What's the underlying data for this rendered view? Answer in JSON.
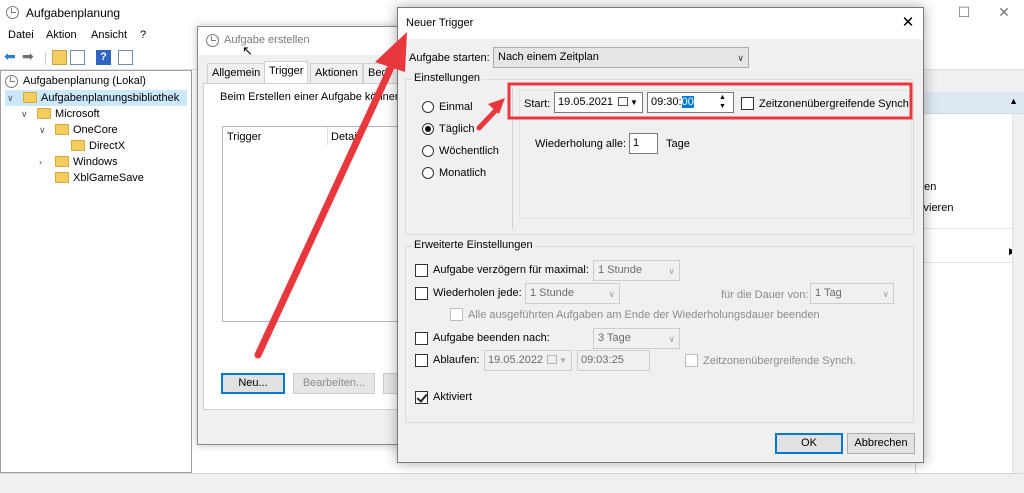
{
  "main": {
    "title": "Aufgabenplanung",
    "menu": [
      "Datei",
      "Aktion",
      "Ansicht",
      "?"
    ],
    "tree": {
      "root": "Aufgabenplanung (Lokal)",
      "library": "Aufgabenplanungsbibliothek",
      "microsoft": "Microsoft",
      "onecore": "OneCore",
      "directx": "DirectX",
      "windows": "Windows",
      "xbl": "XblGameSave"
    },
    "right_pane": {
      "item1": "gen",
      "item2": "tivieren"
    }
  },
  "create_task": {
    "title": "Aufgabe erstellen",
    "tabs": [
      "Allgemein",
      "Trigger",
      "Aktionen",
      "Bed"
    ],
    "description": "Beim Erstellen einer Aufgabe können S",
    "columns": [
      "Trigger",
      "Detail"
    ],
    "buttons": {
      "new": "Neu...",
      "edit": "Bearbeiten..."
    }
  },
  "new_trigger": {
    "title": "Neuer Trigger",
    "start_task_label": "Aufgabe starten:",
    "start_task_value": "Nach einem Zeitplan",
    "settings_label": "Einstellungen",
    "schedule_options": [
      "Einmal",
      "Täglich",
      "Wöchentlich",
      "Monatlich"
    ],
    "selected_option": "Täglich",
    "start_label": "Start:",
    "start_date": "19.05.2021",
    "start_time_prefix": "09:30:",
    "start_time_selected": "00",
    "sync_label": "Zeitzonenübergreifende Synch.",
    "repeat_label": "Wiederholung alle:",
    "repeat_value": "1",
    "repeat_unit": "Tage",
    "advanced_label": "Erweiterte Einstellungen",
    "delay_label": "Aufgabe verzögern für maximal:",
    "delay_value": "1 Stunde",
    "repeat_every_label": "Wiederholen jede:",
    "repeat_every_value": "1 Stunde",
    "duration_label": "für die Dauer von:",
    "duration_value": "1 Tag",
    "stop_all_label": "Alle ausgeführten Aufgaben am Ende der Wiederholungsdauer beenden",
    "stop_after_label": "Aufgabe beenden nach:",
    "stop_after_value": "3 Tage",
    "expire_label": "Ablaufen:",
    "expire_date": "19.05.2022",
    "expire_time": "09:03:25",
    "expire_sync_label": "Zeitzonenübergreifende Synch.",
    "enabled_label": "Aktiviert",
    "ok": "OK",
    "cancel": "Abbrechen"
  },
  "annotation": {
    "arrow_color": "#e8383d",
    "highlight_color": "#e8383d"
  }
}
